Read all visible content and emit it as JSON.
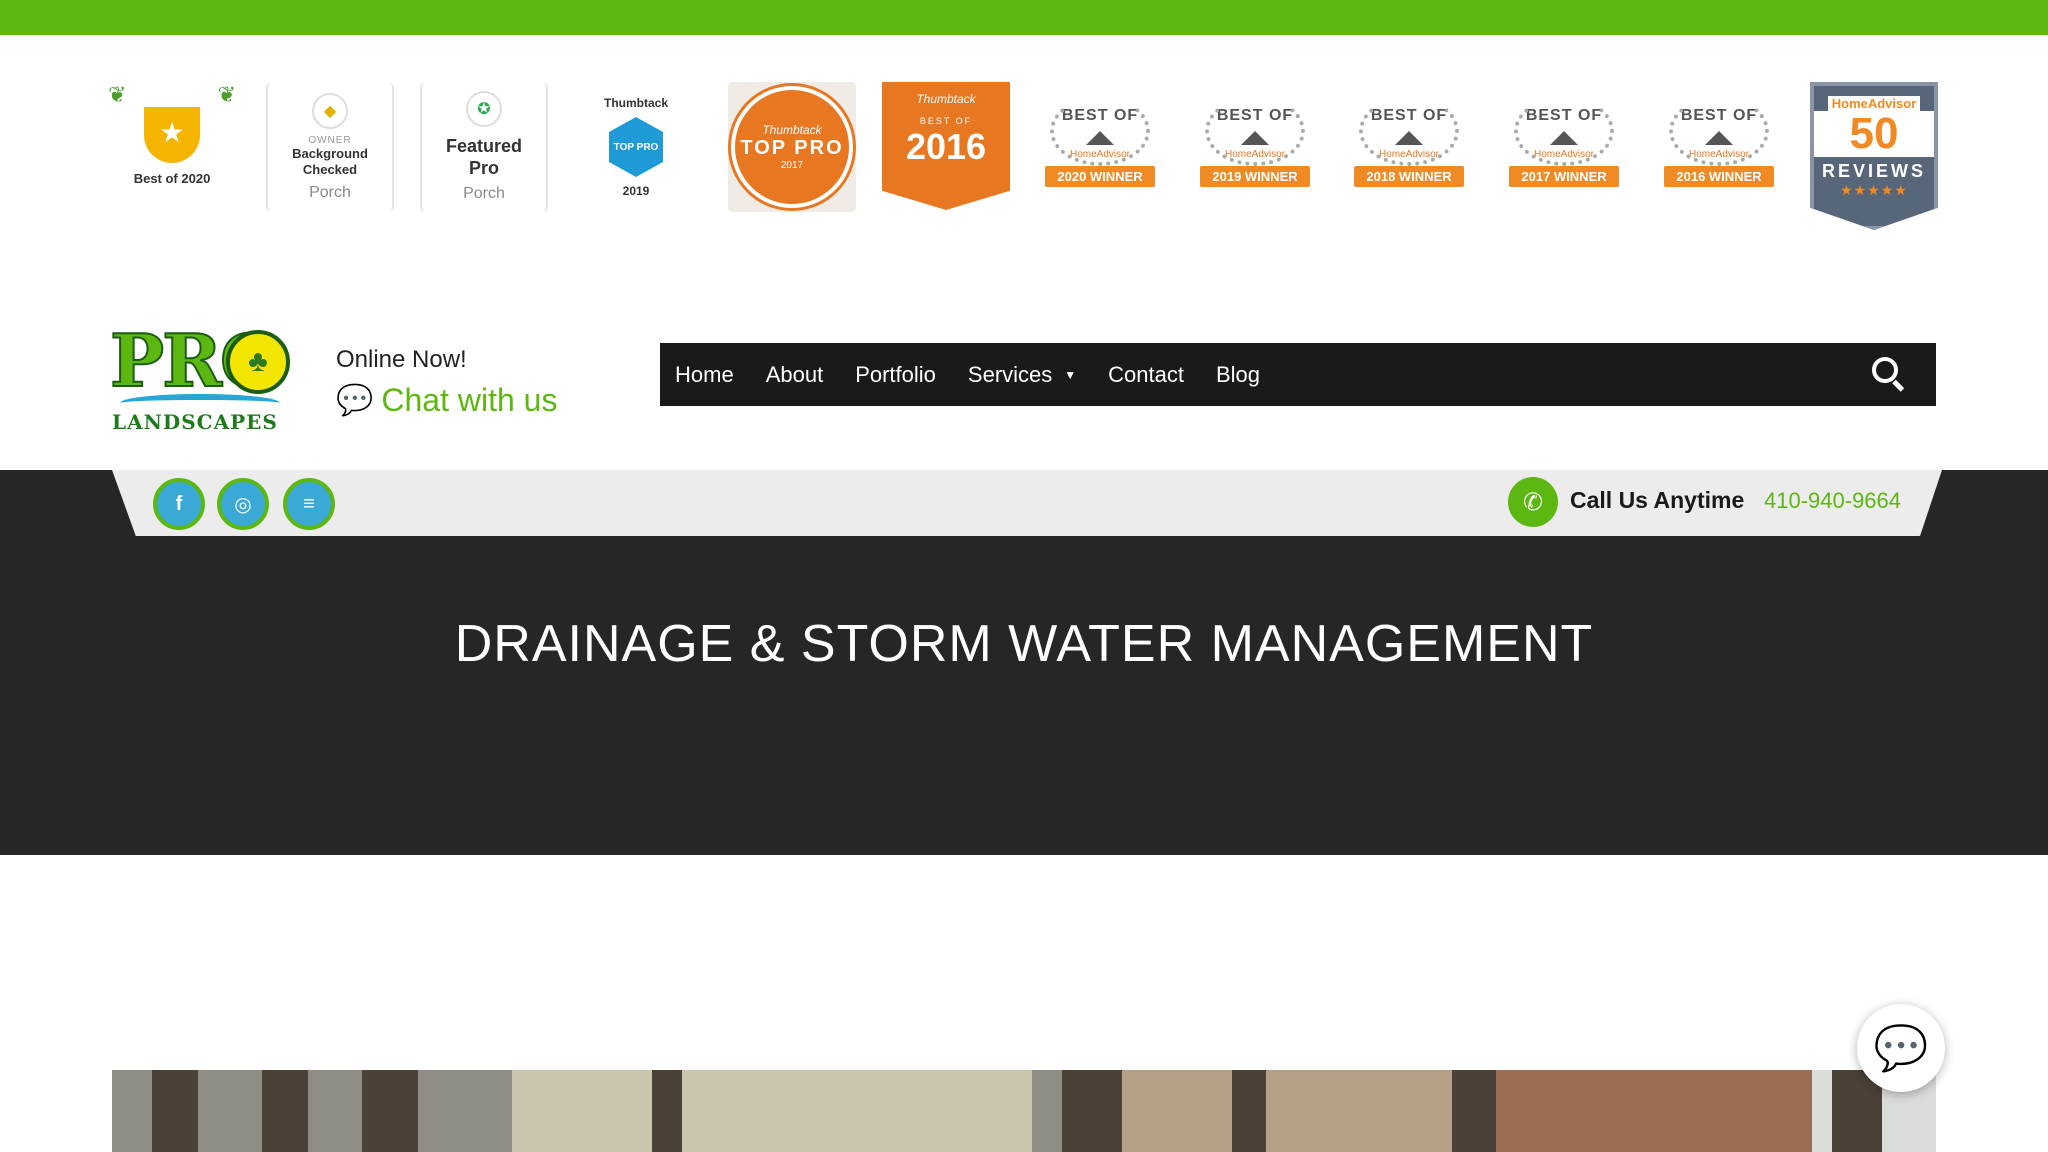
{
  "colors": {
    "accent": "#5cb811",
    "dark": "#262626",
    "nav_bg": "#1a1a1a",
    "orange": "#e87722"
  },
  "awards": {
    "best_of_2020": "Best of 2020",
    "background_checked": {
      "owner": "OWNER",
      "label": "Background Checked",
      "brand": "Porch"
    },
    "featured_pro": {
      "label": "Featured Pro",
      "brand": "Porch"
    },
    "thumbtack_2019": {
      "brand": "Thumbtack",
      "badge": "TOP PRO",
      "year": "2019"
    },
    "thumbtack_2017": {
      "brand": "Thumbtack",
      "badge": "TOP PRO",
      "year": "2017"
    },
    "thumbtack_2016": {
      "brand": "Thumbtack",
      "best_of": "BEST OF",
      "year": "2016"
    },
    "homeadvisor": [
      {
        "best_of": "BEST OF",
        "brand": "HomeAdvisor",
        "ribbon": "2020 WINNER"
      },
      {
        "best_of": "BEST OF",
        "brand": "HomeAdvisor",
        "ribbon": "2019 WINNER"
      },
      {
        "best_of": "BEST OF",
        "brand": "HomeAdvisor",
        "ribbon": "2018 WINNER"
      },
      {
        "best_of": "BEST OF",
        "brand": "HomeAdvisor",
        "ribbon": "2017 WINNER"
      },
      {
        "best_of": "BEST OF",
        "brand": "HomeAdvisor",
        "ribbon": "2016 WINNER"
      }
    ],
    "homeadvisor_reviews": {
      "brand": "HomeAdvisor",
      "count": "50",
      "label": "REVIEWS"
    }
  },
  "logo": {
    "top": "PRO",
    "bottom": "LANDSCAPES"
  },
  "chat_promo": {
    "status": "Online Now!",
    "link": "Chat with us"
  },
  "nav": {
    "items": [
      "Home",
      "About",
      "Portfolio",
      "Services",
      "Contact",
      "Blog"
    ]
  },
  "contact_bar": {
    "social": [
      "facebook-icon",
      "instagram-icon",
      "reviews-icon"
    ],
    "call_label": "Call Us Anytime",
    "phone": "410-940-9664"
  },
  "hero": {
    "title": "DRAINAGE & STORM WATER MANAGEMENT"
  }
}
